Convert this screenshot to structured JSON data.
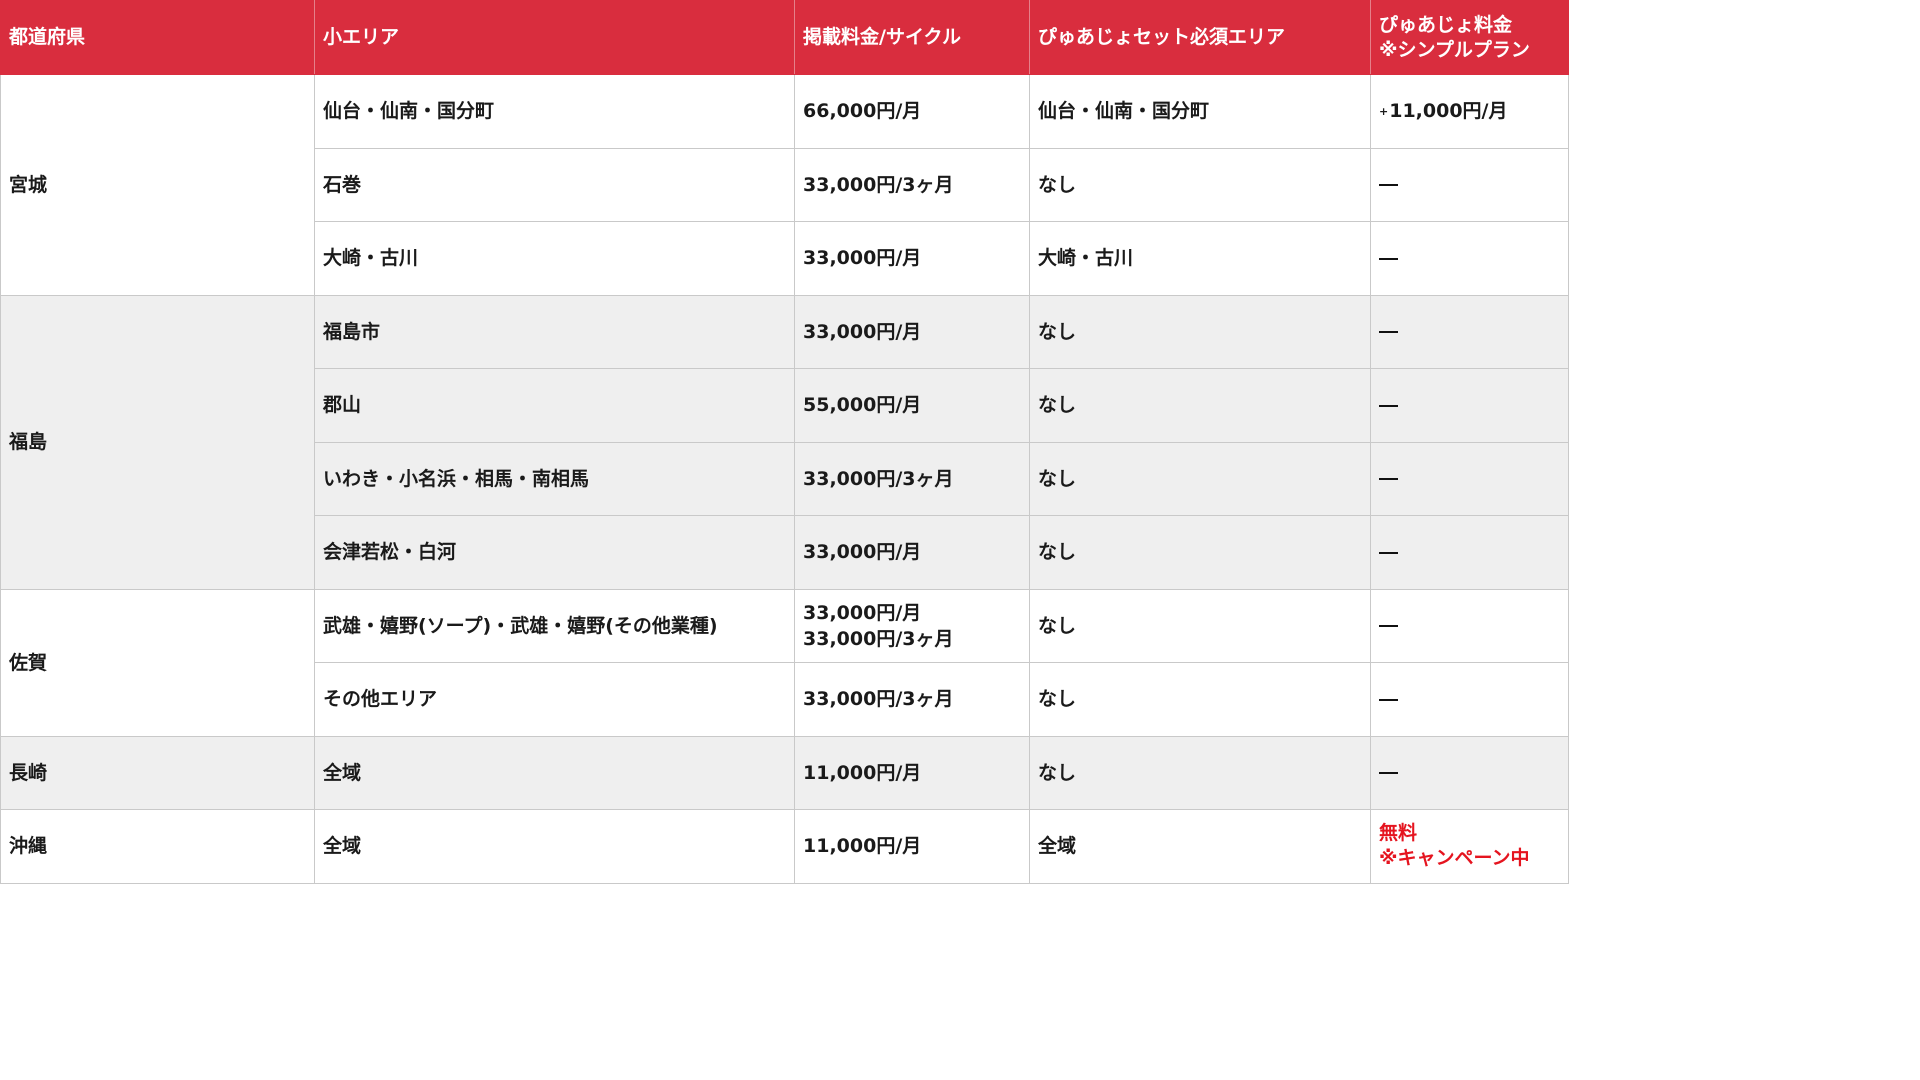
{
  "headers": {
    "prefecture": "都道府県",
    "sub_area": "小エリア",
    "listing_fee": "掲載料金/サイクル",
    "pyuajo_area": "ぴゅあじょセット必須エリア",
    "pyuajo_fee": "ぴゅあじょ料金\n※シンプルプラン"
  },
  "groups": [
    {
      "prefecture": "宮城",
      "rows": [
        {
          "area": "仙台・仙南・国分町",
          "fee": "66,000円/月",
          "required": "仙台・仙南・国分町",
          "pyuajo_prefix": "+",
          "pyuajo": "11,000円/月"
        },
        {
          "area": "石巻",
          "fee": "33,000円/3ヶ月",
          "required": "なし",
          "pyuajo": "dash"
        },
        {
          "area": "大崎・古川",
          "fee": "33,000円/月",
          "required": "大崎・古川",
          "pyuajo": "dash"
        }
      ]
    },
    {
      "prefecture": "福島",
      "rows": [
        {
          "area": "福島市",
          "fee": "33,000円/月",
          "required": "なし",
          "pyuajo": "dash"
        },
        {
          "area": "郡山",
          "fee": "55,000円/月",
          "required": "なし",
          "pyuajo": "dash"
        },
        {
          "area": "いわき・小名浜・相馬・南相馬",
          "fee": "33,000円/3ヶ月",
          "required": "なし",
          "pyuajo": "dash"
        },
        {
          "area": "会津若松・白河",
          "fee": "33,000円/月",
          "required": "なし",
          "pyuajo": "dash"
        }
      ]
    },
    {
      "prefecture": "佐賀",
      "rows": [
        {
          "area": "武雄・嬉野(ソープ)・武雄・嬉野(その他業種)",
          "fee": "33,000円/月\n33,000円/3ヶ月",
          "required": "なし",
          "pyuajo": "dash"
        },
        {
          "area": "その他エリア",
          "fee": "33,000円/3ヶ月",
          "required": "なし",
          "pyuajo": "dash"
        }
      ]
    },
    {
      "prefecture": "長崎",
      "rows": [
        {
          "area": "全域",
          "fee": "11,000円/月",
          "required": "なし",
          "pyuajo": "dash"
        }
      ]
    },
    {
      "prefecture": "沖縄",
      "rows": [
        {
          "area": "全域",
          "fee": "11,000円/月",
          "required": "全域",
          "pyuajo": "無料\n※キャンペーン中",
          "pyuajo_style": "red"
        }
      ]
    }
  ],
  "colors": {
    "header_bg": "#d92d3e",
    "header_text": "#ffffff",
    "alt_row_bg": "#efefef",
    "campaign_text": "#e5141f"
  },
  "icons": {
    "not_applicable": "em-dash-icon"
  }
}
